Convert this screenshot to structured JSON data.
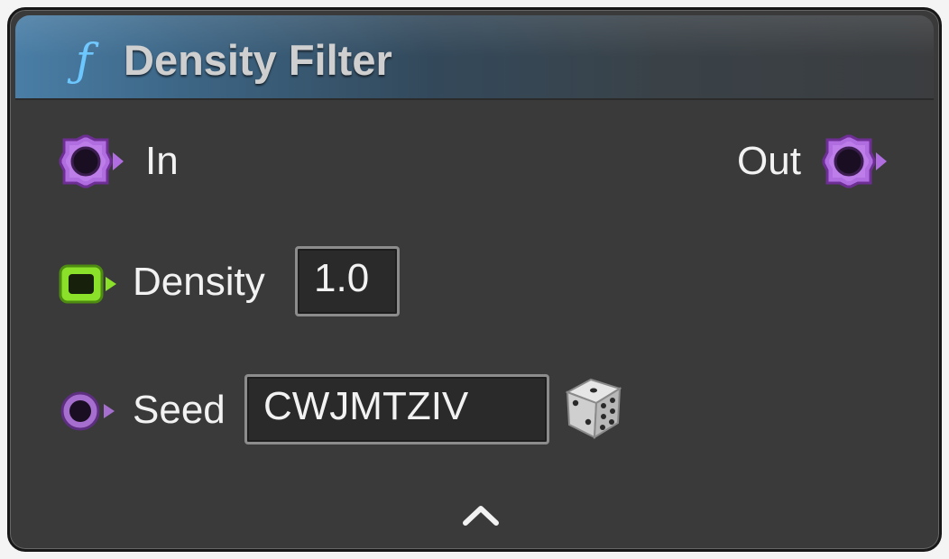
{
  "node": {
    "title": "Density Filter",
    "icon": "function-icon",
    "accent_color": "#4a7ea6",
    "pins": {
      "in_label": "In",
      "out_label": "Out",
      "point_pin_color": "#b06de0",
      "density_pin_color": "#8be02a",
      "seed_pin_color": "#a66fcf"
    },
    "density": {
      "label": "Density",
      "value": "1.0"
    },
    "seed": {
      "label": "Seed",
      "value": "CWJMTZIV",
      "randomize_icon": "dice-icon"
    },
    "collapse_icon": "chevron-up-icon"
  }
}
